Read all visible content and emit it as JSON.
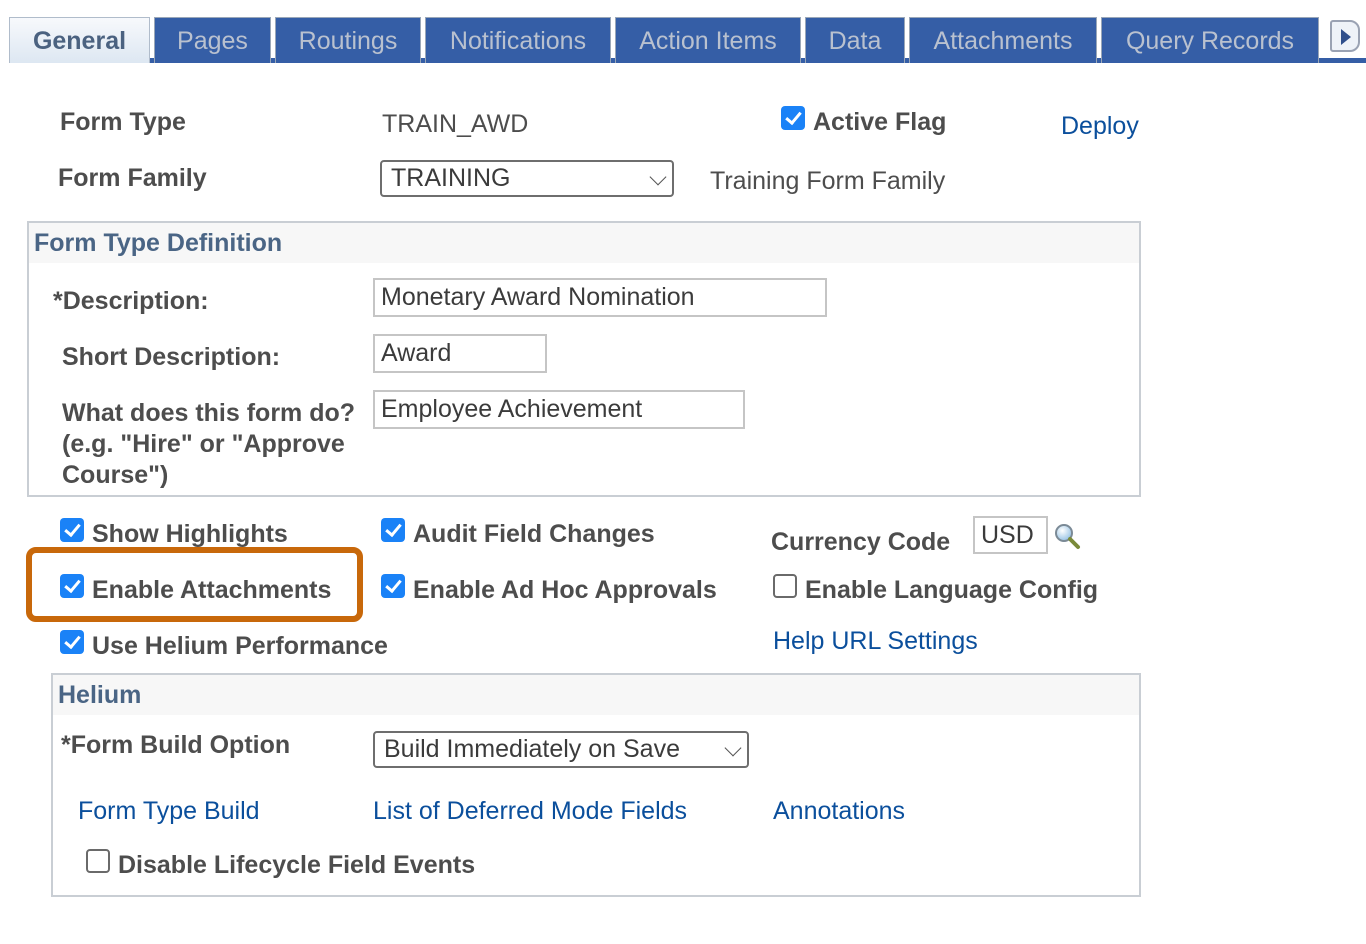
{
  "tabs": [
    {
      "label": "General",
      "active": true
    },
    {
      "label": "Pages"
    },
    {
      "label": "Routings"
    },
    {
      "label": "Notifications"
    },
    {
      "label": "Action Items"
    },
    {
      "label": "Data"
    },
    {
      "label": "Attachments"
    },
    {
      "label": "Query Records"
    }
  ],
  "header": {
    "form_type_label": "Form Type",
    "form_type_value": "TRAIN_AWD",
    "active_flag_label": "Active Flag",
    "active_flag_checked": true,
    "deploy_link": "Deploy",
    "form_family_label": "Form Family",
    "form_family_selected": "TRAINING",
    "form_family_description": "Training Form Family"
  },
  "definition": {
    "title": "Form Type Definition",
    "description_label": "*Description:",
    "description_value": "Monetary Award Nomination",
    "short_description_label": "Short Description:",
    "short_description_value": "Award",
    "what_label_line1": "What does this form do?",
    "what_label_line2": "(e.g. \"Hire\" or \"Approve",
    "what_label_line3": "Course\")",
    "what_value": "Employee Achievement"
  },
  "options": {
    "show_highlights": {
      "label": "Show Highlights",
      "checked": true
    },
    "audit_field_changes": {
      "label": "Audit Field Changes",
      "checked": true
    },
    "currency_code_label": "Currency Code",
    "currency_code_value": "USD",
    "enable_attachments": {
      "label": "Enable Attachments",
      "checked": true
    },
    "enable_ad_hoc_approvals": {
      "label": "Enable Ad Hoc Approvals",
      "checked": true
    },
    "enable_language_config": {
      "label": "Enable Language Config",
      "checked": false
    },
    "use_helium_performance": {
      "label": "Use Helium Performance",
      "checked": true
    },
    "help_url_settings_link": "Help URL Settings",
    "highlight_color": "#c8680a"
  },
  "helium": {
    "title": "Helium",
    "form_build_option_label": "*Form Build Option",
    "form_build_option_selected": "Build Immediately on Save",
    "links": {
      "form_type_build": "Form Type Build",
      "deferred_mode_fields": "List of Deferred Mode Fields",
      "annotations": "Annotations"
    },
    "disable_lifecycle": {
      "label": "Disable Lifecycle Field Events",
      "checked": false
    }
  },
  "colors": {
    "tab_blue": "#355ea6",
    "link_blue": "#0b4f9c",
    "checkbox_blue": "#1a82f7",
    "section_title": "#4a6585"
  }
}
